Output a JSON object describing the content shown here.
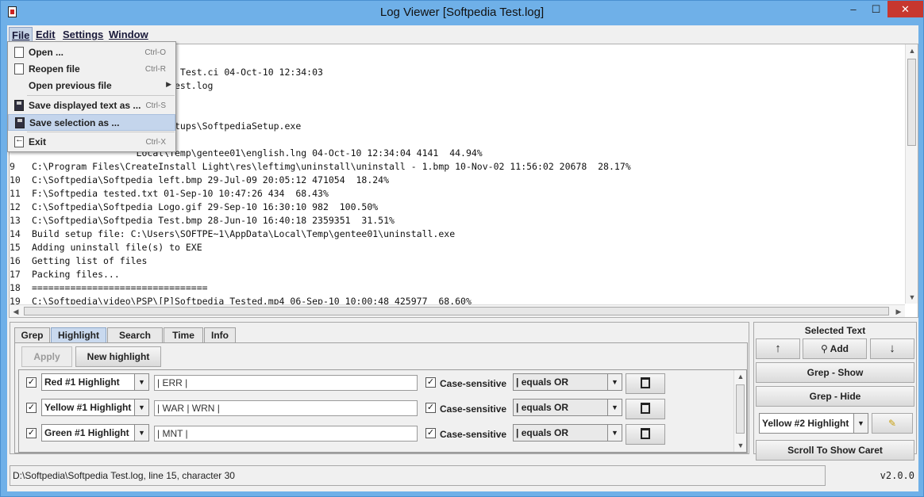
{
  "window": {
    "title": "Log Viewer [Softpedia Test.log]",
    "min": "–",
    "max": "☐",
    "close": "✕"
  },
  "menubar": {
    "file": "File",
    "edit": "Edit",
    "settings": "Settings",
    "window": "Window"
  },
  "file_menu": {
    "open": {
      "label": "Open ...",
      "shortcut": "Ctrl-O"
    },
    "reopen": {
      "label": "Reopen file",
      "shortcut": "Ctrl-R"
    },
    "open_previous": {
      "label": "Open previous file"
    },
    "save_displayed": {
      "label": "Save displayed text as ...",
      "shortcut": "Ctrl-S"
    },
    "save_selection": {
      "label": "Save selection as ..."
    },
    "exit": {
      "label": "Exit",
      "shortcut": "Ctrl-X"
    }
  },
  "editor": {
    "lines": [
      {
        "n": "",
        "text": ""
      },
      {
        "n": "",
        "text": "                   ftpedia Test.ci 04-Oct-10 12:34:03"
      },
      {
        "n": "",
        "text": "                   pedia Test.log"
      },
      {
        "n": "",
        "text": ""
      },
      {
        "n": "",
        "text": "                   ."
      },
      {
        "n": "",
        "text": "                   edia\\setups\\SoftpediaSetup.exe"
      },
      {
        "n": "",
        "text": "                   o EXE"
      },
      {
        "n": "",
        "text": "                   Local\\Temp\\gentee01\\english.lng 04-Oct-10 12:34:04 4141  44.94%"
      },
      {
        "n": "9",
        "text": "C:\\Program Files\\CreateInstall Light\\res\\leftimg\\uninstall\\uninstall - 1.bmp 10-Nov-02 11:56:02 20678  28.17%"
      },
      {
        "n": "10",
        "text": "C:\\Softpedia\\Softpedia left.bmp 29-Jul-09 20:05:12 471054  18.24%"
      },
      {
        "n": "11",
        "text": "F:\\Softpedia tested.txt 01-Sep-10 10:47:26 434  68.43%"
      },
      {
        "n": "12",
        "text": "C:\\Softpedia\\Softpedia Logo.gif 29-Sep-10 16:30:10 982  100.50%"
      },
      {
        "n": "13",
        "text": "C:\\Softpedia\\Softpedia Test.bmp 28-Jun-10 16:40:18 2359351  31.51%"
      },
      {
        "n": "14",
        "text": "Build setup file: C:\\Users\\SOFTPE~1\\AppData\\Local\\Temp\\gentee01\\uninstall.exe"
      },
      {
        "n": "15",
        "text": "Adding uninstall file(s) to EXE"
      },
      {
        "n": "16",
        "text": "Getting list of files"
      },
      {
        "n": "17",
        "text": "Packing files..."
      },
      {
        "n": "18",
        "text": "================================"
      },
      {
        "n": "19",
        "text": "C:\\Softpedia\\video\\PSP\\[P]Softpedia Tested.mp4 06-Sep-10 10:00:48 425977  68.60%"
      }
    ]
  },
  "tabs": {
    "grep": "Grep",
    "highlight": "Highlight",
    "search": "Search",
    "time": "Time",
    "info": "Info"
  },
  "highlight_panel": {
    "apply": "Apply",
    "new_highlight": "New highlight",
    "rows": [
      {
        "name": "Red #1 Highlight",
        "pattern": "| ERR |",
        "case_label": "Case-sensitive",
        "mode": "| equals OR"
      },
      {
        "name": "Yellow #1 Highlight",
        "pattern": "| WAR | WRN |",
        "case_label": "Case-sensitive",
        "mode": "| equals OR"
      },
      {
        "name": "Green #1 Highlight",
        "pattern": "| MNT |",
        "case_label": "Case-sensitive",
        "mode": "| equals OR"
      }
    ]
  },
  "side_panel": {
    "title": "Selected Text",
    "up": "↑",
    "add": "Add",
    "down": "↓",
    "grep_show": "Grep - Show",
    "grep_hide": "Grep - Hide",
    "highlight_select": "Yellow #2 Highlight",
    "scroll_caret": "Scroll To Show Caret"
  },
  "status": {
    "text": "D:\\Softpedia\\Softpedia Test.log, line 15, character 30",
    "version": "v2.0.0"
  }
}
